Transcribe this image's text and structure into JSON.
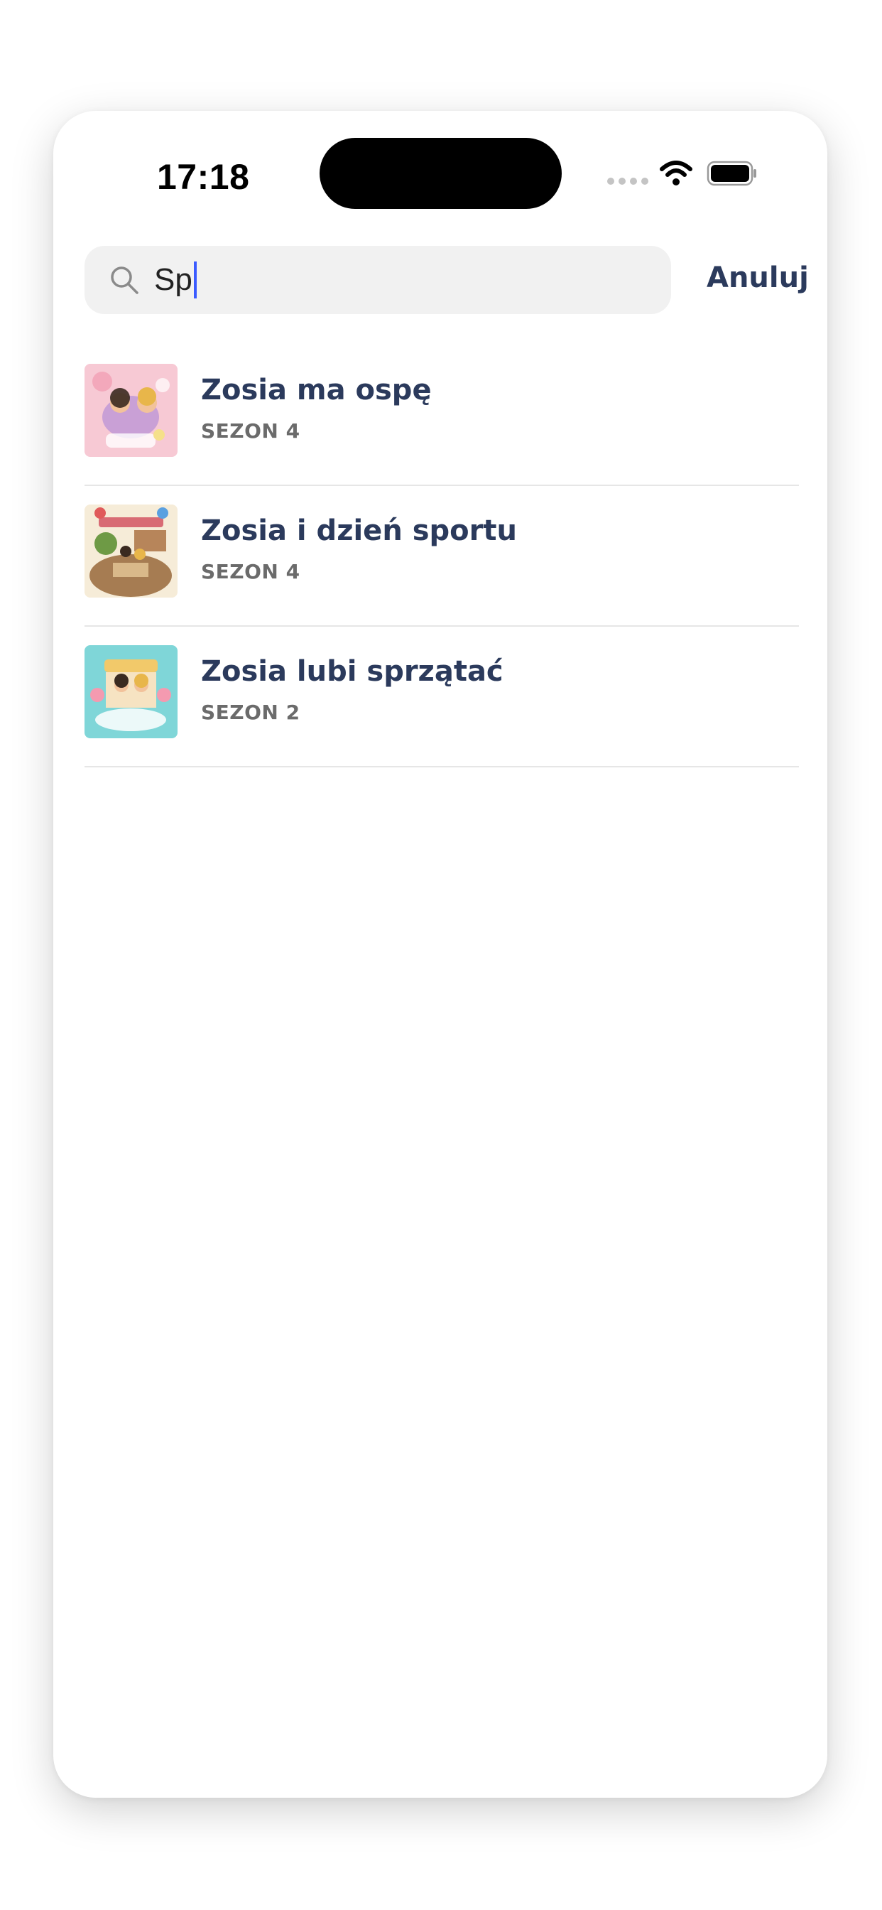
{
  "status_bar": {
    "time": "17:18",
    "signal_icon": "signal-dots-icon",
    "wifi_icon": "wifi-icon",
    "battery_icon": "battery-icon"
  },
  "search": {
    "icon": "search-icon",
    "value": "Sp",
    "cancel_label": "Anuluj"
  },
  "results": [
    {
      "title": "Zosia ma ospę",
      "season": "SEZON 4",
      "thumbnail": "episode-thumbnail-pink"
    },
    {
      "title": "Zosia i dzień sportu",
      "season": "SEZON 4",
      "thumbnail": "episode-thumbnail-sports"
    },
    {
      "title": "Zosia lubi sprzątać",
      "season": "SEZON 2",
      "thumbnail": "episode-thumbnail-teal"
    }
  ],
  "colors": {
    "title": "#2b3a5c",
    "subtitle": "#6b6b6b",
    "search_bg": "#f1f1f1",
    "caret": "#3b5bff",
    "divider": "#e6e6e6"
  }
}
